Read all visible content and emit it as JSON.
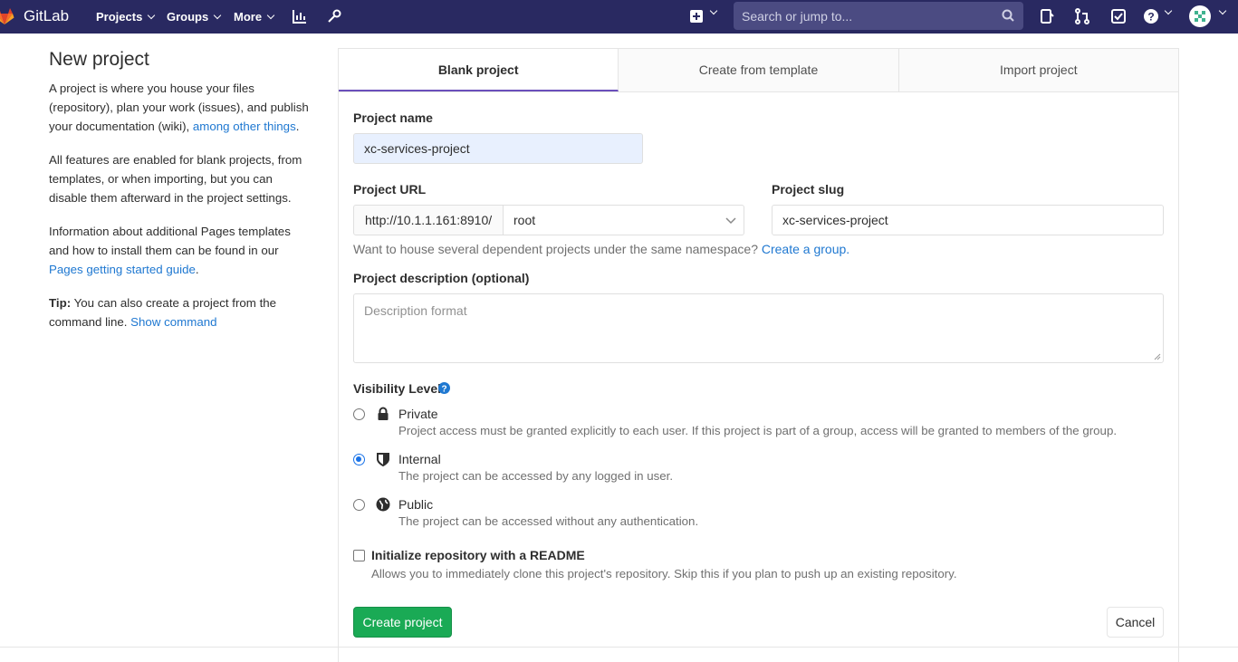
{
  "navbar": {
    "brand": "GitLab",
    "projects": "Projects",
    "groups": "Groups",
    "more": "More",
    "search_placeholder": "Search or jump to...",
    "icons": [
      "activity-chart-icon",
      "admin-wrench-icon",
      "plus-square-icon",
      "issues-icon",
      "merge-request-icon",
      "todo-icon",
      "help-icon",
      "avatar"
    ]
  },
  "sidebar": {
    "title": "New project",
    "p1_text": "A project is where you house your files (repository), plan your work (issues), and publish your documentation (wiki), ",
    "p1_link": "among other things",
    "p1_end": ".",
    "p2": "All features are enabled for blank projects, from templates, or when importing, but you can disable them afterward in the project settings.",
    "p3_text": "Information about additional Pages templates and how to install them can be found in our ",
    "p3_link": "Pages getting started guide",
    "p3_end": ".",
    "tip_label": "Tip:",
    "tip_text": " You can also create a project from the command line. ",
    "tip_link": "Show command"
  },
  "tabs": [
    "Blank project",
    "Create from template",
    "Import project"
  ],
  "form": {
    "project_name_label": "Project name",
    "project_name_value": "xc-services-project",
    "project_url_label": "Project URL",
    "url_prefix": "http://10.1.1.161:8910/",
    "namespace": "root",
    "project_slug_label": "Project slug",
    "project_slug_value": "xc-services-project",
    "group_help": "Want to house several dependent projects under the same namespace? ",
    "group_link": "Create a group.",
    "description_label": "Project description (optional)",
    "description_placeholder": "Description format",
    "visibility_label": "Visibility Level",
    "visibility": [
      {
        "title": "Private",
        "desc": "Project access must be granted explicitly to each user. If this project is part of a group, access will be granted to members of the group.",
        "selected": false
      },
      {
        "title": "Internal",
        "desc": "The project can be accessed by any logged in user.",
        "selected": true
      },
      {
        "title": "Public",
        "desc": "The project can be accessed without any authentication.",
        "selected": false
      }
    ],
    "readme_label": "Initialize repository with a README",
    "readme_desc": "Allows you to immediately clone this project's repository. Skip this if you plan to push up an existing repository.",
    "create_button": "Create project",
    "cancel_button": "Cancel"
  },
  "colors": {
    "navbar": "#292961",
    "accent": "#6b4fbb",
    "create": "#1aaa55",
    "link": "#1f78d1"
  }
}
